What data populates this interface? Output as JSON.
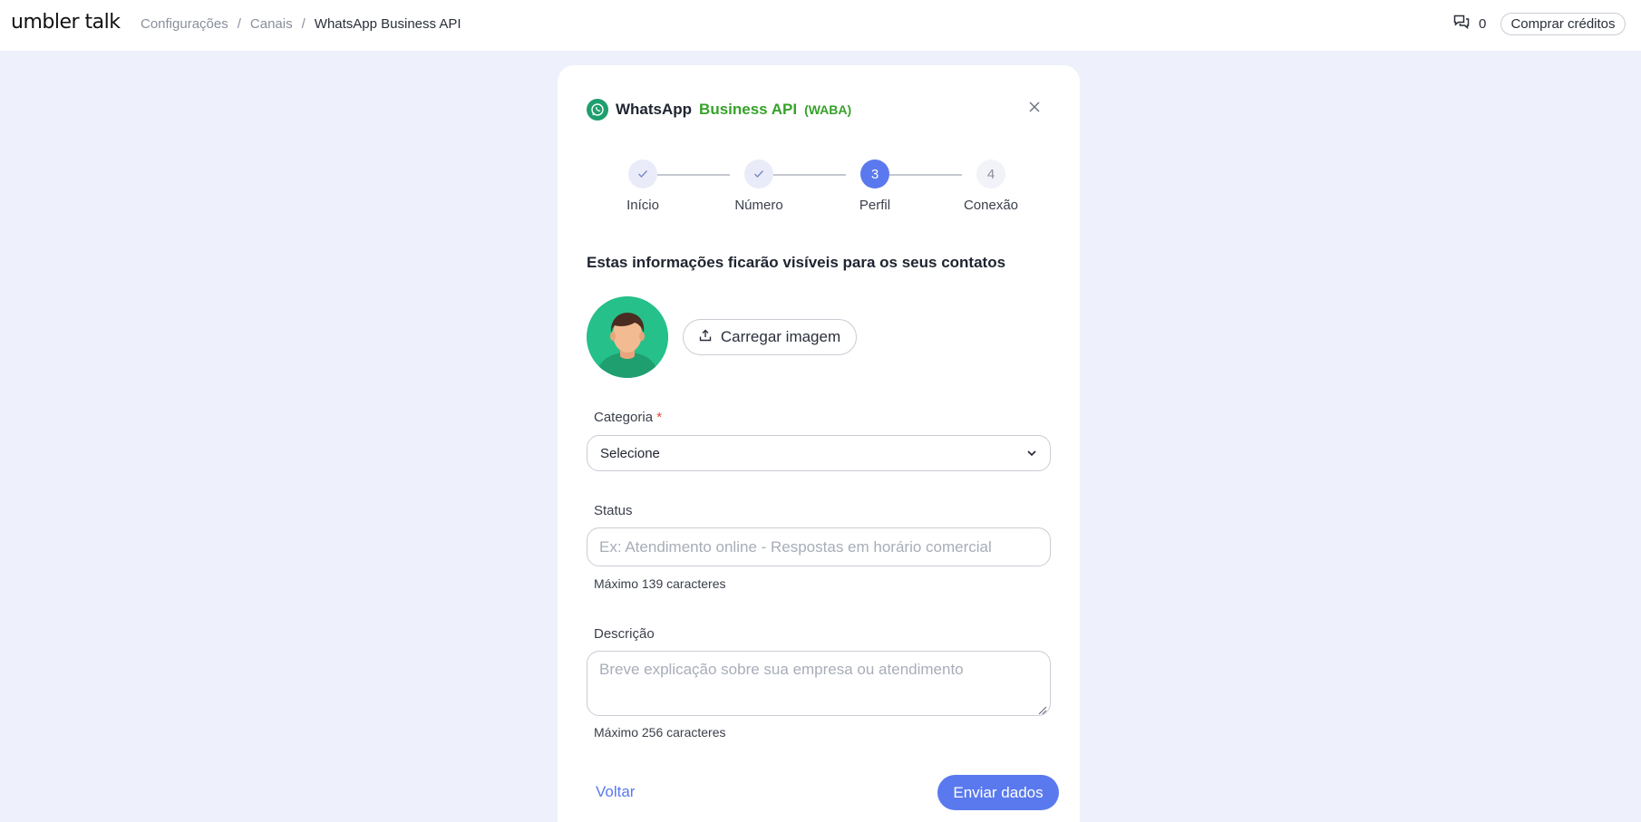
{
  "app": {
    "logo_text": "umbler talk"
  },
  "breadcrumb": [
    {
      "label": "Configurações"
    },
    {
      "label": "Canais"
    },
    {
      "label": "WhatsApp Business API"
    }
  ],
  "breadcrumb_separator": "/",
  "header": {
    "messages_count": "0",
    "buy_credits_label": "Comprar créditos"
  },
  "modal": {
    "title_part1": "WhatsApp",
    "title_part2": "Business API",
    "title_part3": "(WABA)",
    "steps": [
      {
        "number": "1",
        "label": "Início",
        "state": "done"
      },
      {
        "number": "2",
        "label": "Número",
        "state": "done"
      },
      {
        "number": "3",
        "label": "Perfil",
        "state": "active"
      },
      {
        "number": "4",
        "label": "Conexão",
        "state": "todo"
      }
    ],
    "section_title": "Estas informações ficarão visíveis para os seus contatos",
    "upload_label": "Carregar imagem",
    "category": {
      "label": "Categoria",
      "required_mark": "*",
      "selected_value": "Selecione"
    },
    "status": {
      "label": "Status",
      "placeholder": "Ex: Atendimento online - Respostas em horário comercial",
      "hint": "Máximo 139 caracteres"
    },
    "description": {
      "label": "Descrição",
      "placeholder": "Breve explicação sobre sua empresa ou atendimento",
      "hint": "Máximo 256 caracteres"
    },
    "back_label": "Voltar",
    "submit_label": "Enviar dados"
  },
  "colors": {
    "accent": "#5a79ee",
    "brand_green": "#36a22a",
    "background": "#eef0fb"
  },
  "icons": {
    "chat": "chat-bubbles-icon",
    "whatsapp": "whatsapp-icon",
    "close": "close-icon",
    "check": "check-icon",
    "upload": "upload-icon",
    "chevron": "chevron-down-icon"
  }
}
